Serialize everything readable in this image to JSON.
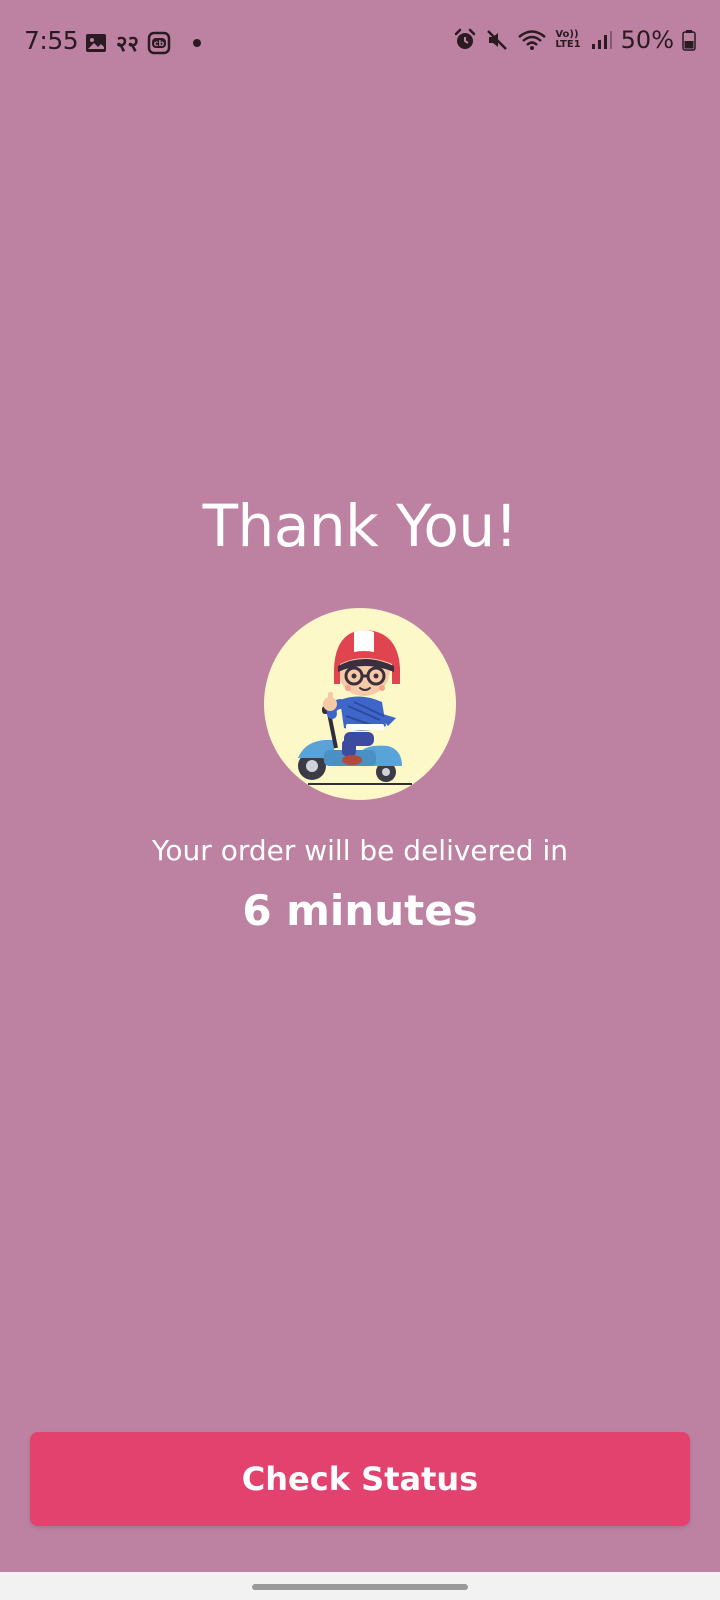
{
  "status_bar": {
    "time": "7:55",
    "sim_label": "२२",
    "battery": "50%",
    "icons": [
      "gallery-icon",
      "cb-app-icon",
      "alarm-icon",
      "mute-icon",
      "wifi-icon",
      "volte-icon",
      "signal-icon",
      "battery-icon"
    ],
    "volte_label_top": "Vo))",
    "volte_label_bottom": "LTE1"
  },
  "main": {
    "title": "Thank You!",
    "illustration": "delivery-scooter-illustration",
    "subtitle": "Your order will be delivered in",
    "eta": "6 minutes"
  },
  "footer": {
    "check_status_label": "Check Status"
  },
  "colors": {
    "background": "#bd82a2",
    "button": "#e3426f",
    "avatar_bg": "#fdf8c7",
    "text": "#ffffff"
  }
}
